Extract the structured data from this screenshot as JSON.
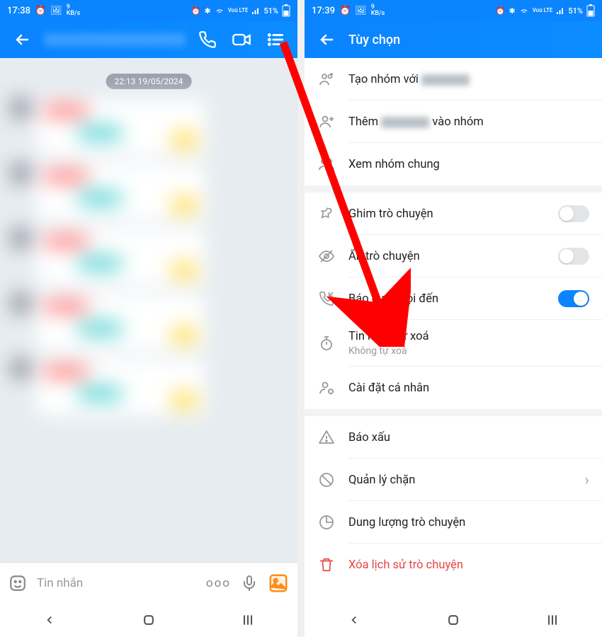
{
  "status_left": {
    "time1": "17:38",
    "time2": "17:39",
    "speed": "9",
    "speed_unit": "KB/s"
  },
  "status_right": {
    "net": "Voû LTE",
    "battery": "51%"
  },
  "chat": {
    "date_pill": "22:13 19/05/2024",
    "composer_placeholder": "Tin nhắn"
  },
  "options": {
    "header_title": "Tùy chọn",
    "create_group_prefix": "Tạo nhóm với ",
    "add_to_group_prefix": "Thêm ",
    "add_to_group_suffix": " vào nhóm",
    "view_common_groups": "Xem nhóm chung",
    "pin_chat": "Ghim trò chuyện",
    "hide_chat": "Ẩn trò chuyện",
    "incoming_call": "Báo cuộc gọi đến",
    "self_delete": "Tin nhắn tự xoá",
    "self_delete_sub": "Không tự xoá",
    "personal_settings": "Cài đặt cá nhân",
    "report": "Báo xấu",
    "block_manage": "Quản lý chặn",
    "storage": "Dung lượng trò chuyện",
    "delete_history": "Xóa lịch sử trò chuyện",
    "toggle_pin": false,
    "toggle_hide": false,
    "toggle_call": true
  },
  "composer_dots": "ooo"
}
